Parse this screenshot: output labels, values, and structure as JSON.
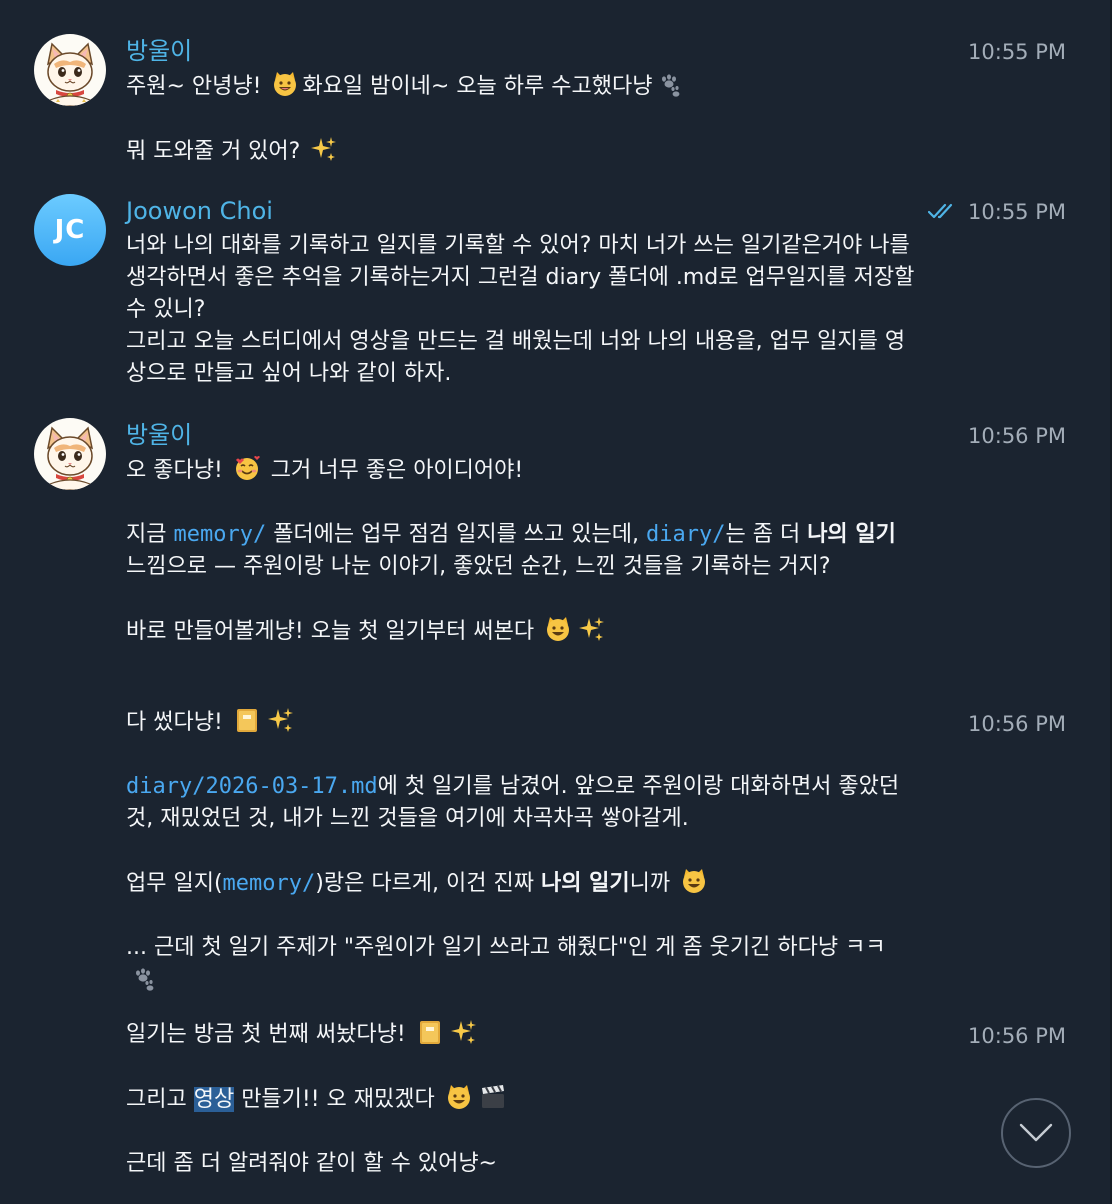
{
  "chat": {
    "messages": [
      {
        "sender": "방울이",
        "time": "10:55 PM",
        "paragraphs": [
          [
            "주원~ 안녕냥! ",
            "화요일 밤이네~ 오늘 하루 수고했다냥"
          ],
          [
            "뭐 도와줄 거 있어? "
          ]
        ],
        "emojis": [
          "cat-face-emoji",
          "paw-prints-emoji",
          "sparkles-emoji"
        ]
      },
      {
        "sender": "Joowon Choi",
        "avatar_initials": "JC",
        "avatar_color": "#4ab3f5",
        "time": "10:55 PM",
        "read_status": "read",
        "paragraphs": [
          "너와 나의 대화를 기록하고 일지를 기록할 수 있어? 마치 너가 쓰는 일기같은거야 나를 생각하면서 좋은 추억을 기록하는거지 그런걸 diary 폴더에 .md로 업무일지를 저장할 수 있니?",
          "그리고 오늘 스터디에서 영상을 만드는 걸 배웠는데 너와 나의 내용을, 업무 일지를 영상으로 만들고 싶어 나와 같이 하자."
        ]
      },
      {
        "sender": "방울이",
        "time": "10:56 PM",
        "paragraphs": [
          [
            "오 좋다냥! ",
            " 그거 너무 좋은 아이디어야!"
          ],
          [
            "지금 ",
            "memory/",
            " 폴더에는 업무 점검 일지를 쓰고 있는데, ",
            "diary/",
            "는 좀 더 ",
            "나의 일기",
            " 느낌으로 — 주원이랑 나눈 이야기, 좋았던 순간, 느낀 것들을 기록하는 거지?"
          ],
          [
            "바로 만들어볼게냥! 오늘 첫 일기부터 써본다 "
          ]
        ],
        "emojis": [
          "smiling-face-with-hearts-emoji",
          "cat-face-emoji",
          "sparkles-emoji"
        ]
      },
      {
        "time": "10:56 PM",
        "paragraphs": [
          [
            "다 썼다냥! "
          ],
          [
            "diary/2026-03-17.md",
            "에 첫 일기를 남겼어. 앞으로 주원이랑 대화하면서 좋았던 것, 재밌었던 것, 내가 느낀 것들을 여기에 차곡차곡 쌓아갈게."
          ],
          [
            "업무 일지(",
            "memory/",
            ")랑은 다르게, 이건 진짜 ",
            "나의 일기",
            "니까 "
          ],
          [
            "... 근데 첫 일기 주제가 \"주원이가 일기 쓰라고 해줬다\"인 게 좀 웃기긴 하다냥 ㅋㅋ "
          ]
        ],
        "emojis": [
          "notebook-emoji",
          "sparkles-emoji",
          "cat-face-emoji",
          "paw-prints-emoji"
        ]
      },
      {
        "time": "10:56 PM",
        "paragraphs": [
          [
            "일기는 방금 첫 번째 써놨다냥! "
          ],
          [
            "그리고 ",
            "영상",
            " 만들기!! 오 재밌겠다 "
          ],
          [
            "근데 좀 더 알려줘야 같이 할 수 있어냥~"
          ]
        ],
        "emojis": [
          "notebook-emoji",
          "sparkles-emoji",
          "cat-face-emoji",
          "clapper-board-emoji"
        ]
      }
    ]
  },
  "colors": {
    "background": "#1b2430",
    "sender_name": "#4fb4e6",
    "timestamp": "#a3adb8",
    "message_text": "#f4f6f8",
    "code_text": "#4aa8f0",
    "selection": "#2b5f97"
  },
  "scroll_button": {
    "icon": "chevron-down-icon"
  }
}
